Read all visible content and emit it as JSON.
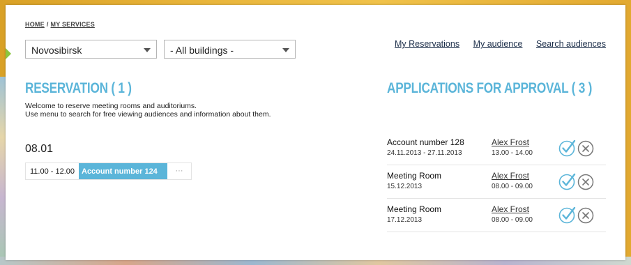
{
  "breadcrumb": {
    "home": "HOME",
    "separator": "/",
    "current": "MY SERVICES"
  },
  "filters": {
    "city": "Novosibirsk",
    "building": "- All buildings -"
  },
  "top_links": {
    "my_reservations": "My Reservations",
    "my_audience": "My audience",
    "search_audiences": "Search audiences"
  },
  "reservation": {
    "title": "RESERVATION ( 1 )",
    "welcome_line1": "Welcome to reserve meeting rooms and auditoriums.",
    "welcome_line2": "Use menu to search for free viewing audiences and information about them.",
    "date": "08.01",
    "slot": {
      "time": "11.00 - 12.00",
      "event": "Account number 124",
      "more": "···"
    }
  },
  "applications": {
    "title": "APPLICATIONS FOR APPROVAL ( 3 )",
    "items": [
      {
        "title": "Account number 128",
        "dates": "24.11.2013 - 27.11.2013",
        "user": "Alex Frost",
        "time": "13.00 - 14.00"
      },
      {
        "title": "Meeting Room",
        "dates": "15.12.2013",
        "user": "Alex Frost",
        "time": "08.00 - 09.00"
      },
      {
        "title": "Meeting Room",
        "dates": "17.12.2013",
        "user": "Alex Frost",
        "time": "08.00 - 09.00"
      }
    ]
  },
  "colors": {
    "accent": "#5bb5d9",
    "marker": "#8cc63f",
    "frame": "#e8b43a"
  },
  "icons": {
    "approve": "check-circle-icon",
    "reject": "x-circle-icon",
    "dropdown": "chevron-down-icon",
    "active_marker": "arrow-right-icon"
  }
}
